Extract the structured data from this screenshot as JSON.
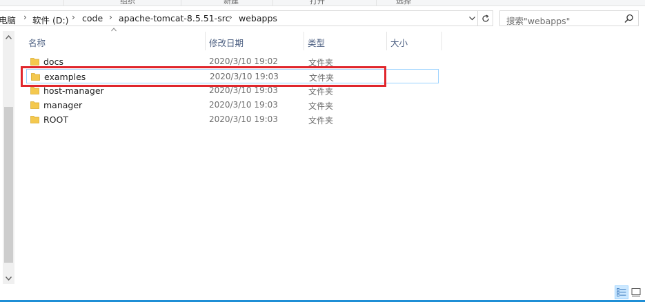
{
  "ribbon": {
    "groups": [
      "组织",
      "新建",
      "打开",
      "选择"
    ]
  },
  "address": {
    "crumbs": [
      "电脑",
      "软件 (D:)",
      "code",
      "apache-tomcat-8.5.51-src",
      "webapps"
    ],
    "separator": "›"
  },
  "search": {
    "placeholder": "搜索\"webapps\""
  },
  "columns": {
    "name": "名称",
    "modified": "修改日期",
    "type": "类型",
    "size": "大小"
  },
  "files": [
    {
      "name": "docs",
      "modified": "2020/3/10 19:02",
      "type": "文件夹",
      "size": ""
    },
    {
      "name": "examples",
      "modified": "2020/3/10 19:03",
      "type": "文件夹",
      "size": ""
    },
    {
      "name": "host-manager",
      "modified": "2020/3/10 19:03",
      "type": "文件夹",
      "size": ""
    },
    {
      "name": "manager",
      "modified": "2020/3/10 19:03",
      "type": "文件夹",
      "size": ""
    },
    {
      "name": "ROOT",
      "modified": "2020/3/10 19:03",
      "type": "文件夹",
      "size": ""
    }
  ],
  "highlighted_item": "examples",
  "colors": {
    "highlight": "#e0262c",
    "folder": "#f4c84e",
    "accent": "#1f8fd6",
    "header_text": "#4d6082"
  },
  "icons": [
    "folder-icon",
    "search-icon",
    "refresh-icon",
    "chevron-down-icon",
    "details-view-icon",
    "large-icons-view-icon"
  ]
}
